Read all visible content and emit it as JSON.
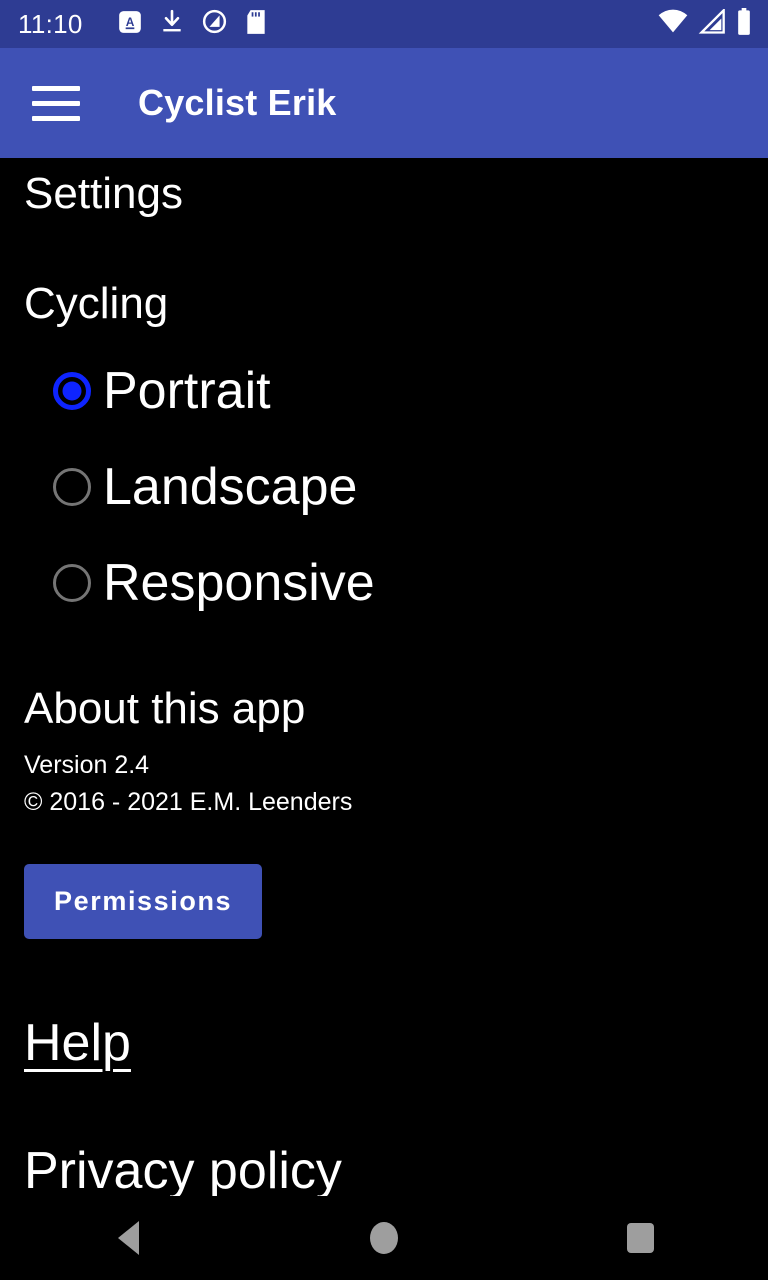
{
  "status_bar": {
    "time": "11:10",
    "left_icons": [
      "keyboard-language-icon",
      "download-icon",
      "android-q-icon",
      "sd-card-icon"
    ],
    "right_icons": [
      "wifi-icon",
      "cellular-signal-icon",
      "battery-icon"
    ],
    "background_color": "#2E3C93"
  },
  "app_bar": {
    "menu_icon": "hamburger-menu-icon",
    "title": "Cyclist Erik",
    "background_color": "#3F51B5"
  },
  "content": {
    "page_title": "Settings",
    "section": {
      "heading": "Cycling",
      "selected_option": "Portrait",
      "options": [
        {
          "label": "Portrait",
          "selected": true
        },
        {
          "label": "Landscape",
          "selected": false
        },
        {
          "label": "Responsive",
          "selected": false
        }
      ],
      "selected_color": "#0E24FF",
      "unselected_color": "#757575"
    },
    "about": {
      "heading": "About this app",
      "version": "Version 2.4",
      "copyright": "© 2016 - 2021 E.M. Leenders"
    },
    "permissions_button": "Permissions",
    "links": [
      {
        "label": "Help"
      },
      {
        "label": "Privacy policy"
      }
    ]
  },
  "nav_bar": {
    "back": "back-nav-button",
    "home": "home-nav-button",
    "recents": "recents-nav-button",
    "icon_color": "#9E9E9E"
  }
}
